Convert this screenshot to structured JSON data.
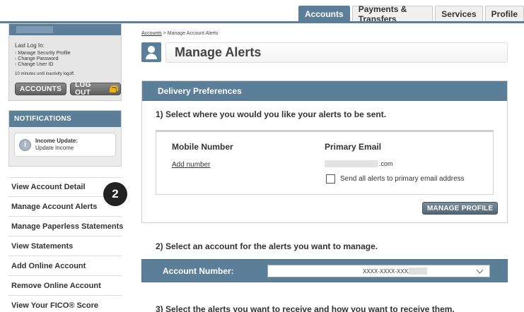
{
  "topnav": {
    "tabs": [
      {
        "label": "Accounts"
      },
      {
        "label": "Payments & Transfers"
      },
      {
        "label": "Services"
      },
      {
        "label": "Profile"
      }
    ]
  },
  "login": {
    "last_login_label": "Last Log In:",
    "links": [
      "Manage Security Profile",
      "Change Password",
      "Change User ID"
    ],
    "timeout": "10 minutes until inactivity logoff.",
    "accounts_button": "ACCOUNTS",
    "logout_button": "LOG OUT"
  },
  "notifications": {
    "title": "NOTIFICATIONS",
    "item_title": "Income Update:",
    "item_text": "Update Income"
  },
  "menu": [
    "View Account Detail",
    "Manage Account Alerts",
    "Manage Paperless Statements",
    "View Statements",
    "Add Online Account",
    "Remove Online Account",
    "View Your FICO® Score"
  ],
  "step_badge": "2",
  "breadcrumb": {
    "link": "Accounts",
    "separator": ">",
    "current": "Manage Account Alerts"
  },
  "page_title": "Manage Alerts",
  "delivery": {
    "heading": "Delivery Preferences",
    "step1": "1) Select where you would you like your alerts to be sent.",
    "mobile_label": "Mobile Number",
    "add_number": "Add number",
    "email_label": "Primary Email",
    "email_suffix": ".com",
    "send_all_label": "Send all alerts to primary email address",
    "manage_profile_button": "MANAGE PROFILE"
  },
  "account_select": {
    "step2": "2) Select an account for the alerts you want to manage.",
    "label": "Account Number:",
    "value": "XXXX-XXXX-XXXX-"
  },
  "step3": "3) Select the alerts you want to receive and how you want to receive them.",
  "colors": {
    "accent": "#5b7f99",
    "button_dark": "#5f5f5f",
    "lock": "#f0b400"
  }
}
